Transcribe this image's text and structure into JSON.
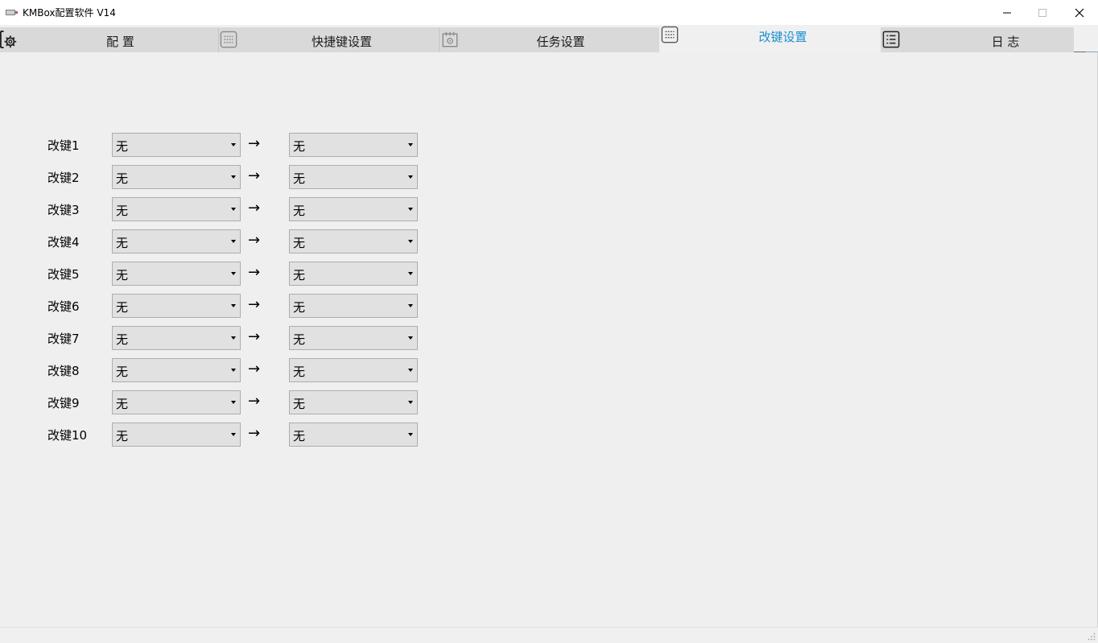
{
  "window": {
    "title": "KMBox配置软件 V14",
    "icons": {
      "app": "keyboard-icon",
      "minimize": "minimize-icon",
      "maximize": "maximize-icon",
      "close": "close-icon"
    }
  },
  "tabs": [
    {
      "label": "配 置",
      "icon": "gear-icon",
      "active": false
    },
    {
      "label": "快捷键设置",
      "icon": "keyboard-icon",
      "active": false
    },
    {
      "label": "任务设置",
      "icon": "calendar-icon",
      "active": false
    },
    {
      "label": "改键设置",
      "icon": "keyboard-icon",
      "active": true
    },
    {
      "label": "日 志",
      "icon": "list-icon",
      "active": false
    }
  ],
  "colors": {
    "active_tab_text": "#1a8fd1",
    "background": "#f0f0f0",
    "combo_bg": "#e1e1e1"
  },
  "remap": {
    "arrow": "→",
    "rows": [
      {
        "label": "改键1",
        "from": "无",
        "to": "无"
      },
      {
        "label": "改键2",
        "from": "无",
        "to": "无"
      },
      {
        "label": "改键3",
        "from": "无",
        "to": "无"
      },
      {
        "label": "改键4",
        "from": "无",
        "to": "无"
      },
      {
        "label": "改键5",
        "from": "无",
        "to": "无"
      },
      {
        "label": "改键6",
        "from": "无",
        "to": "无"
      },
      {
        "label": "改键7",
        "from": "无",
        "to": "无"
      },
      {
        "label": "改键8",
        "from": "无",
        "to": "无"
      },
      {
        "label": "改键9",
        "from": "无",
        "to": "无"
      },
      {
        "label": "改键10",
        "from": "无",
        "to": "无"
      }
    ]
  }
}
